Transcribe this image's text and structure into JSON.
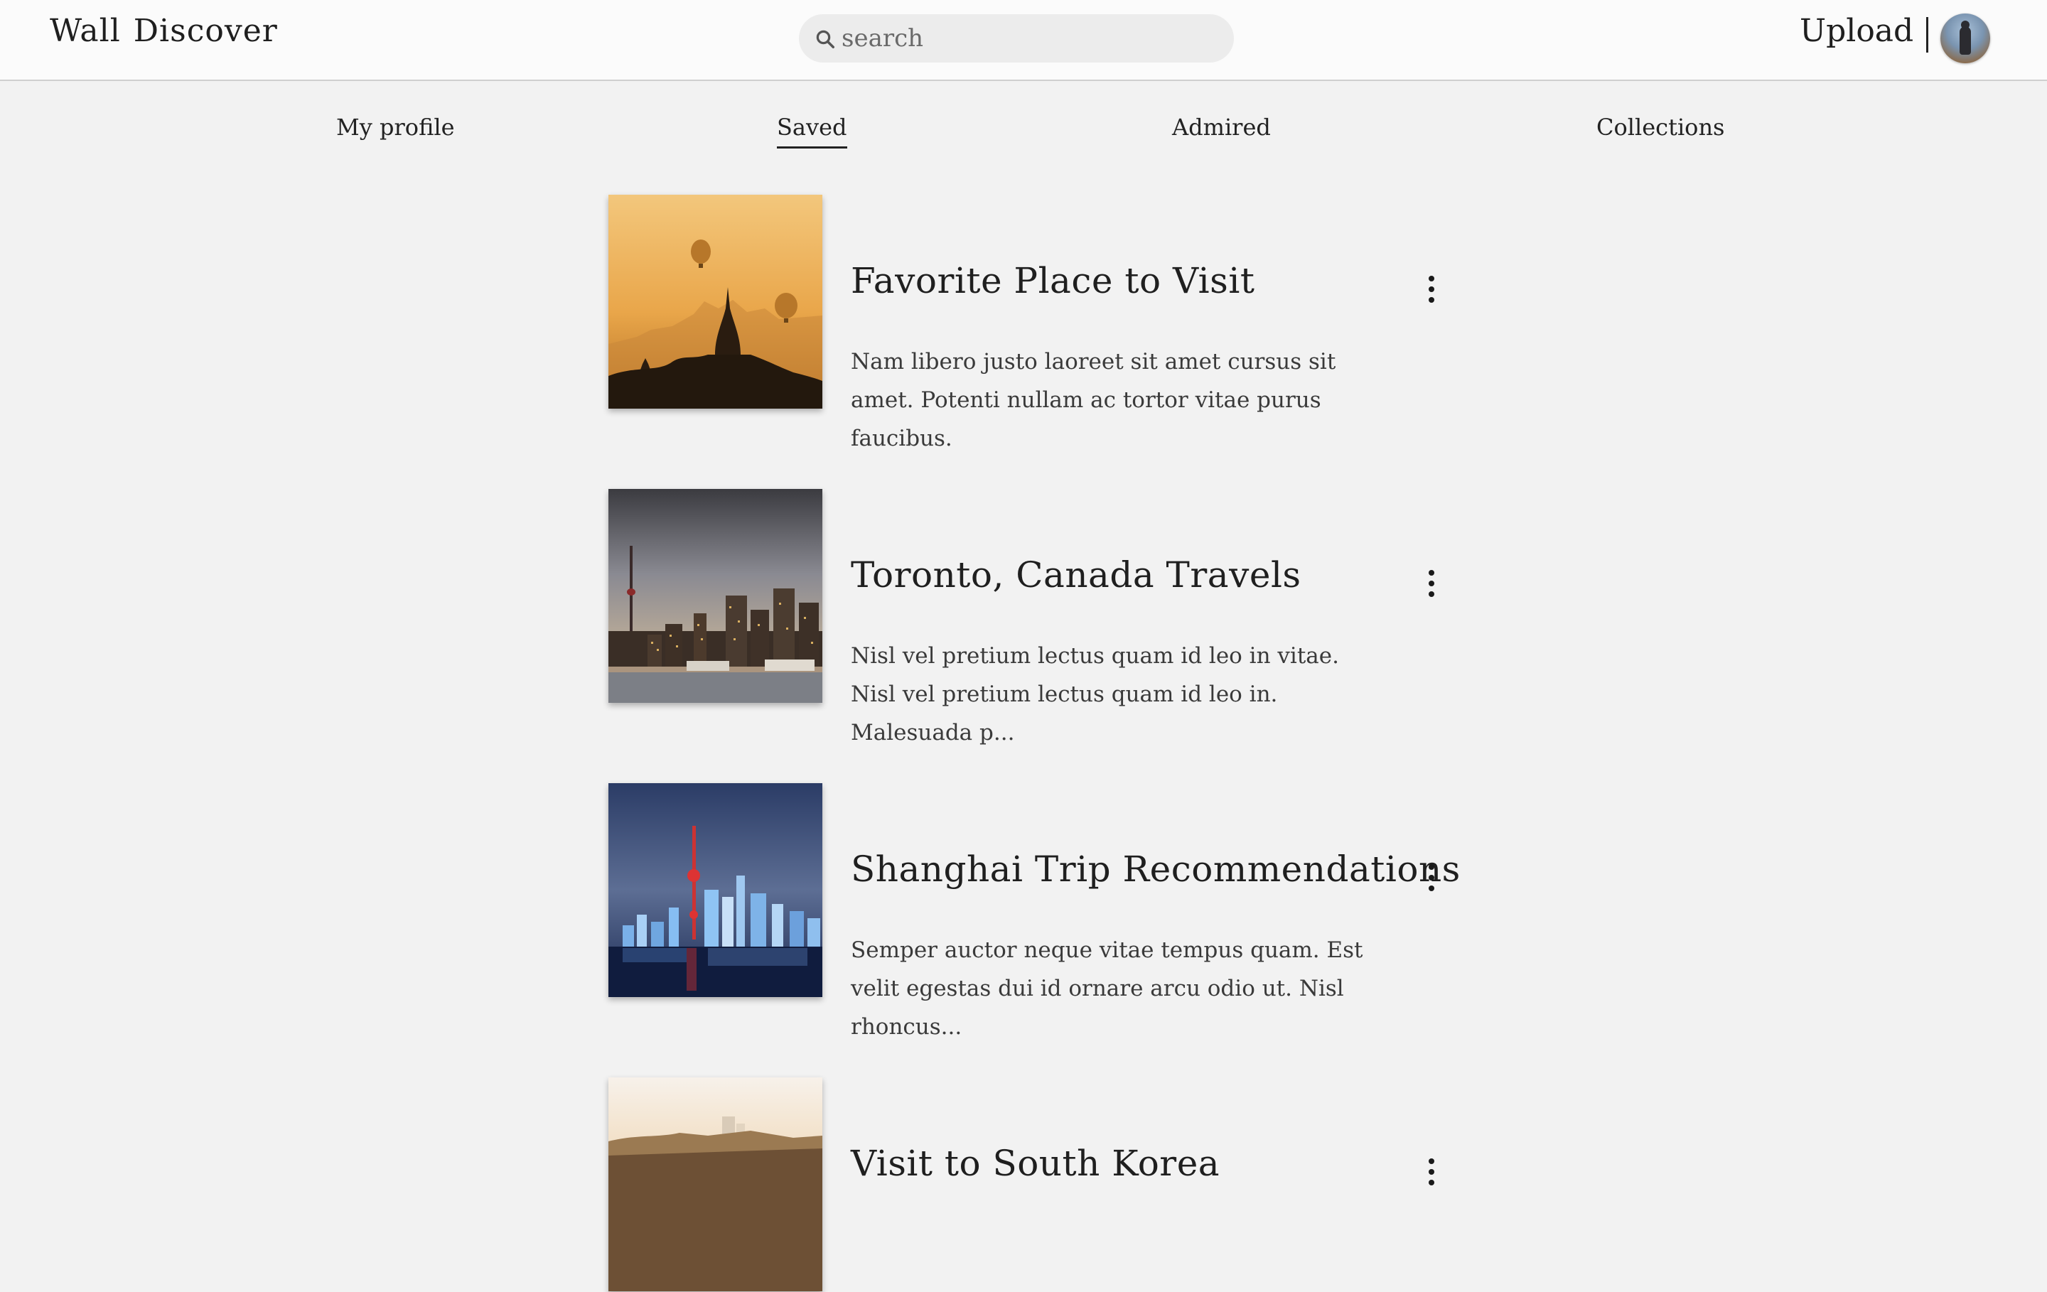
{
  "header": {
    "logo_left": "Wall",
    "logo_right": "Discover",
    "search_placeholder": "search",
    "upload_label": "Upload"
  },
  "tabs": [
    {
      "label": "My profile",
      "active": false
    },
    {
      "label": "Saved",
      "active": true
    },
    {
      "label": "Admired",
      "active": false
    },
    {
      "label": "Collections",
      "active": false
    }
  ],
  "saved_items": [
    {
      "title": "Favorite Place to Visit",
      "description": "Nam libero justo laoreet sit amet cursus sit amet. Potenti nullam ac tortor vitae purus faucibus."
    },
    {
      "title": "Toronto, Canada Travels",
      "description": "Nisl vel pretium lectus quam id leo in vitae. Nisl vel pretium lectus quam id leo in. Malesuada p..."
    },
    {
      "title": "Shanghai Trip Recommendations",
      "description": "Semper auctor neque vitae tempus quam. Est velit egestas dui id ornare arcu odio ut. Nisl rhoncus..."
    },
    {
      "title": "Visit to South Korea",
      "description": ""
    }
  ],
  "icons": {
    "search": "search-icon",
    "more": "more-vertical-icon",
    "avatar": "user-avatar"
  },
  "colors": {
    "page_background": "#f2f2f2",
    "header_background": "#fbfbfb",
    "search_background": "#ececec"
  }
}
